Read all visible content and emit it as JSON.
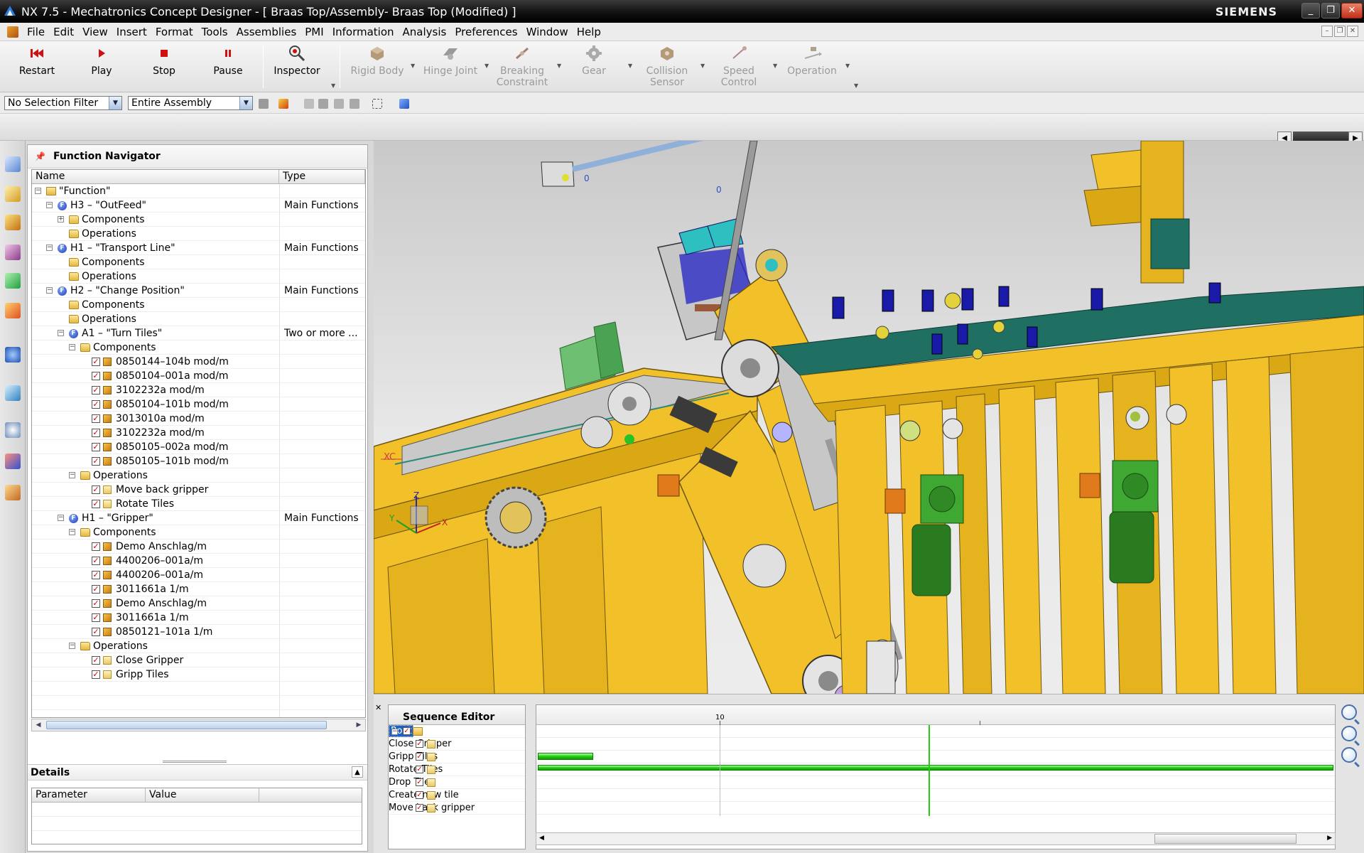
{
  "window": {
    "title": "NX 7.5 - Mechatronics Concept Designer - [ Braas Top/Assembly- Braas Top (Modified) ]",
    "brand": "SIEMENS",
    "controls": [
      "_",
      "❐",
      "✕"
    ]
  },
  "menubar": {
    "items": [
      "File",
      "Edit",
      "View",
      "Insert",
      "Format",
      "Tools",
      "Assemblies",
      "PMI",
      "Information",
      "Analysis",
      "Preferences",
      "Window",
      "Help"
    ],
    "mdi_controls": [
      "–",
      "❐",
      "✕"
    ]
  },
  "ribbon": {
    "restart": "Restart",
    "play": "Play",
    "stop": "Stop",
    "pause": "Pause",
    "inspector": "Inspector",
    "rigid_body": "Rigid Body",
    "hinge_joint": "Hinge Joint",
    "breaking_constraint": "Breaking Constraint",
    "gear": "Gear",
    "collision_sensor": "Collision Sensor",
    "speed_control": "Speed Control",
    "operation": "Operation"
  },
  "selection": {
    "filter": "No Selection Filter",
    "scope": "Entire Assembly"
  },
  "navigator": {
    "title": "Function Navigator",
    "columns": {
      "name": "Name",
      "type": "Type"
    },
    "rows": [
      {
        "name": "\"Function\"",
        "type": ""
      },
      {
        "name": "H3 – \"OutFeed\"",
        "type": "Main Functions"
      },
      {
        "name": "Components",
        "type": ""
      },
      {
        "name": "Operations",
        "type": ""
      },
      {
        "name": "H1 – \"Transport Line\"",
        "type": "Main Functions"
      },
      {
        "name": "Components",
        "type": ""
      },
      {
        "name": "Operations",
        "type": ""
      },
      {
        "name": "H2 – \"Change Position\"",
        "type": "Main Functions"
      },
      {
        "name": "Components",
        "type": ""
      },
      {
        "name": "Operations",
        "type": ""
      },
      {
        "name": "A1 – \"Turn Tiles\"",
        "type": "Two or more ..."
      },
      {
        "name": "Components",
        "type": ""
      },
      {
        "name": "0850144–104b mod/m",
        "type": ""
      },
      {
        "name": "0850104–001a mod/m",
        "type": ""
      },
      {
        "name": "3102232a mod/m",
        "type": ""
      },
      {
        "name": "0850104–101b mod/m",
        "type": ""
      },
      {
        "name": "3013010a mod/m",
        "type": ""
      },
      {
        "name": "3102232a mod/m",
        "type": ""
      },
      {
        "name": "0850105–002a mod/m",
        "type": ""
      },
      {
        "name": "0850105–101b mod/m",
        "type": ""
      },
      {
        "name": "Operations",
        "type": ""
      },
      {
        "name": "Move back gripper",
        "type": ""
      },
      {
        "name": "Rotate Tiles",
        "type": ""
      },
      {
        "name": "H1 – \"Gripper\"",
        "type": "Main Functions"
      },
      {
        "name": "Components",
        "type": ""
      },
      {
        "name": "Demo Anschlag/m",
        "type": ""
      },
      {
        "name": "4400206–001a/m",
        "type": ""
      },
      {
        "name": "4400206–001a/m",
        "type": ""
      },
      {
        "name": "3011661a 1/m",
        "type": ""
      },
      {
        "name": "Demo Anschlag/m",
        "type": ""
      },
      {
        "name": "3011661a 1/m",
        "type": ""
      },
      {
        "name": "0850121–101a 1/m",
        "type": ""
      },
      {
        "name": "Operations",
        "type": ""
      },
      {
        "name": "Close Gripper",
        "type": ""
      },
      {
        "name": "Gripp Tiles",
        "type": ""
      }
    ]
  },
  "details": {
    "title": "Details",
    "columns": {
      "parameter": "Parameter",
      "value": "Value"
    }
  },
  "viewport": {
    "triad_labels": {
      "z": "Z",
      "x": "X",
      "y": "Y"
    },
    "xc_label": "XC",
    "marker_0a": "0",
    "marker_0b": "0"
  },
  "sequence_editor": {
    "title": "Sequence Editor",
    "root": "Root",
    "items": [
      "Close Gripper",
      "Gripp Tiles",
      "Rotate Tiles",
      "Drop Tiles",
      "Create new tile",
      "Move back gripper"
    ],
    "ruler_label": "10"
  },
  "colors": {
    "machine_yellow": "#f2c12a",
    "motor_green": "#3fa832",
    "conveyor_teal": "#1f6f62",
    "timeline_green": "#22cc10"
  }
}
